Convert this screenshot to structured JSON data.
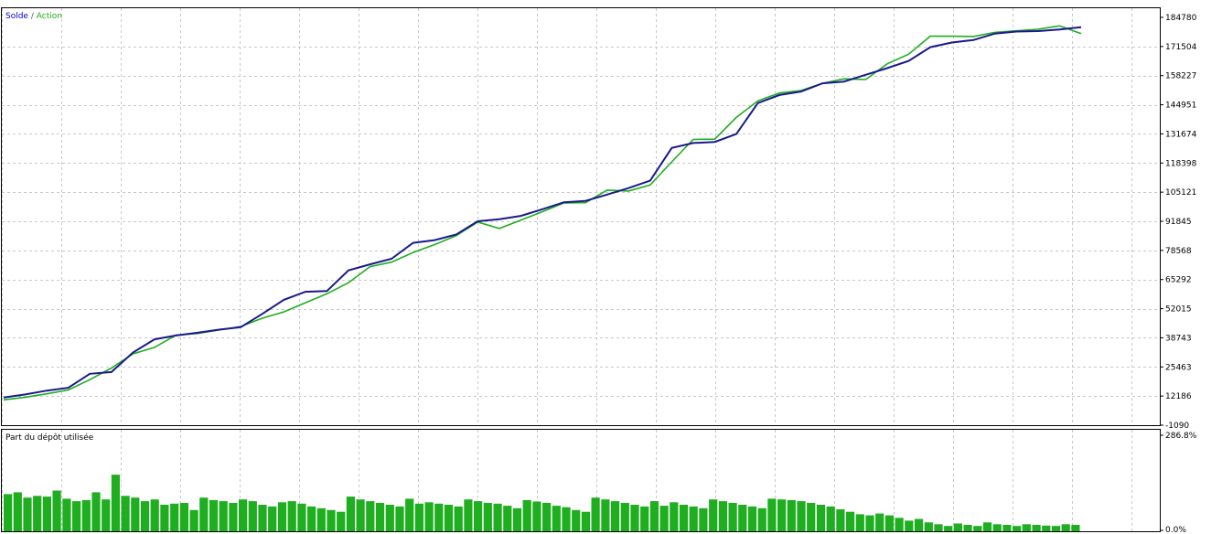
{
  "chart_data": [
    {
      "type": "line",
      "legend": {
        "position": "top-left",
        "entries": [
          {
            "label": "Solde",
            "color": "#0000cd"
          },
          {
            "label": "Action",
            "color": "#1fae1f"
          }
        ],
        "separator": " / "
      },
      "y_ticks": [
        "184780",
        "171504",
        "158227",
        "144951",
        "131674",
        "118398",
        "105121",
        "91845",
        "78568",
        "65292",
        "52015",
        "38743",
        "25463",
        "12186",
        "-1090"
      ],
      "ylim": [
        -1090,
        184780
      ],
      "grid": true,
      "series": [
        {
          "name": "Solde",
          "color": "#1a1a8c",
          "x": [
            0,
            0.02,
            0.04,
            0.06,
            0.08,
            0.1,
            0.12,
            0.14,
            0.16,
            0.18,
            0.2,
            0.22,
            0.24,
            0.26,
            0.28,
            0.3,
            0.32,
            0.34,
            0.36,
            0.38,
            0.4,
            0.42,
            0.44,
            0.46,
            0.48,
            0.5,
            0.52,
            0.54,
            0.56,
            0.58,
            0.6,
            0.62,
            0.64,
            0.66,
            0.68,
            0.7,
            0.72,
            0.74,
            0.76,
            0.78,
            0.8,
            0.82,
            0.84,
            0.86,
            0.88,
            0.9,
            0.92,
            0.94,
            0.96,
            0.98,
            1.0
          ],
          "values": [
            11200,
            12600,
            14300,
            15600,
            21800,
            22600,
            31300,
            37200,
            38900,
            40100,
            41500,
            42600,
            48500,
            54800,
            58400,
            58700,
            67900,
            70600,
            73100,
            80200,
            81400,
            83900,
            89800,
            90700,
            92200,
            95200,
            98300,
            98900,
            101700,
            104600,
            107900,
            122500,
            124700,
            125200,
            128700,
            142500,
            146100,
            147600,
            151300,
            152100,
            155100,
            158100,
            161300,
            167400,
            169500,
            170600,
            173500,
            174400,
            174600,
            175300,
            176300
          ]
        },
        {
          "name": "Action",
          "color": "#1fae1f",
          "x": [
            0,
            0.02,
            0.04,
            0.06,
            0.08,
            0.1,
            0.12,
            0.14,
            0.16,
            0.18,
            0.2,
            0.22,
            0.24,
            0.26,
            0.28,
            0.3,
            0.32,
            0.34,
            0.36,
            0.38,
            0.4,
            0.42,
            0.44,
            0.46,
            0.48,
            0.5,
            0.52,
            0.54,
            0.56,
            0.58,
            0.6,
            0.62,
            0.64,
            0.66,
            0.68,
            0.7,
            0.72,
            0.74,
            0.76,
            0.78,
            0.8,
            0.82,
            0.84,
            0.86,
            0.88,
            0.9,
            0.92,
            0.94,
            0.96,
            0.98,
            1.0
          ],
          "values": [
            10200,
            11400,
            12900,
            14600,
            19200,
            24400,
            30700,
            33600,
            39100,
            39800,
            41400,
            42900,
            46600,
            49400,
            53500,
            57500,
            62400,
            69600,
            71600,
            75900,
            79400,
            83400,
            89500,
            86600,
            90300,
            94100,
            98000,
            98100,
            103700,
            103300,
            106000,
            116300,
            126300,
            126400,
            136100,
            143500,
            147000,
            148100,
            151300,
            153300,
            153000,
            160000,
            164300,
            172300,
            172300,
            172200,
            174000,
            174700,
            175400,
            176900,
            173500
          ]
        }
      ]
    },
    {
      "type": "bar",
      "title": "Part du dépôt utilisée",
      "y_ticks": [
        "286.8%",
        "0.0%"
      ],
      "ylim": [
        0,
        286.8
      ],
      "grid": true,
      "series": [
        {
          "name": "Part du dépôt utilisée",
          "color": "#1fae1f",
          "values": [
            105,
            110,
            95,
            100,
            98,
            115,
            92,
            85,
            88,
            110,
            90,
            160,
            100,
            95,
            85,
            90,
            75,
            78,
            80,
            60,
            95,
            88,
            85,
            80,
            90,
            85,
            75,
            70,
            82,
            85,
            78,
            70,
            65,
            60,
            55,
            98,
            90,
            85,
            80,
            75,
            70,
            92,
            78,
            82,
            78,
            75,
            70,
            90,
            85,
            80,
            78,
            72,
            65,
            88,
            84,
            80,
            72,
            68,
            60,
            55,
            95,
            90,
            85,
            80,
            75,
            70,
            85,
            72,
            82,
            75,
            70,
            65,
            90,
            85,
            80,
            75,
            70,
            65,
            92,
            90,
            88,
            85,
            80,
            75,
            70,
            62,
            55,
            48,
            45,
            50,
            45,
            38,
            30,
            35,
            25,
            20,
            15,
            22,
            18,
            15,
            25,
            20,
            18,
            15,
            20,
            18,
            16,
            15,
            20,
            18
          ]
        }
      ]
    }
  ]
}
